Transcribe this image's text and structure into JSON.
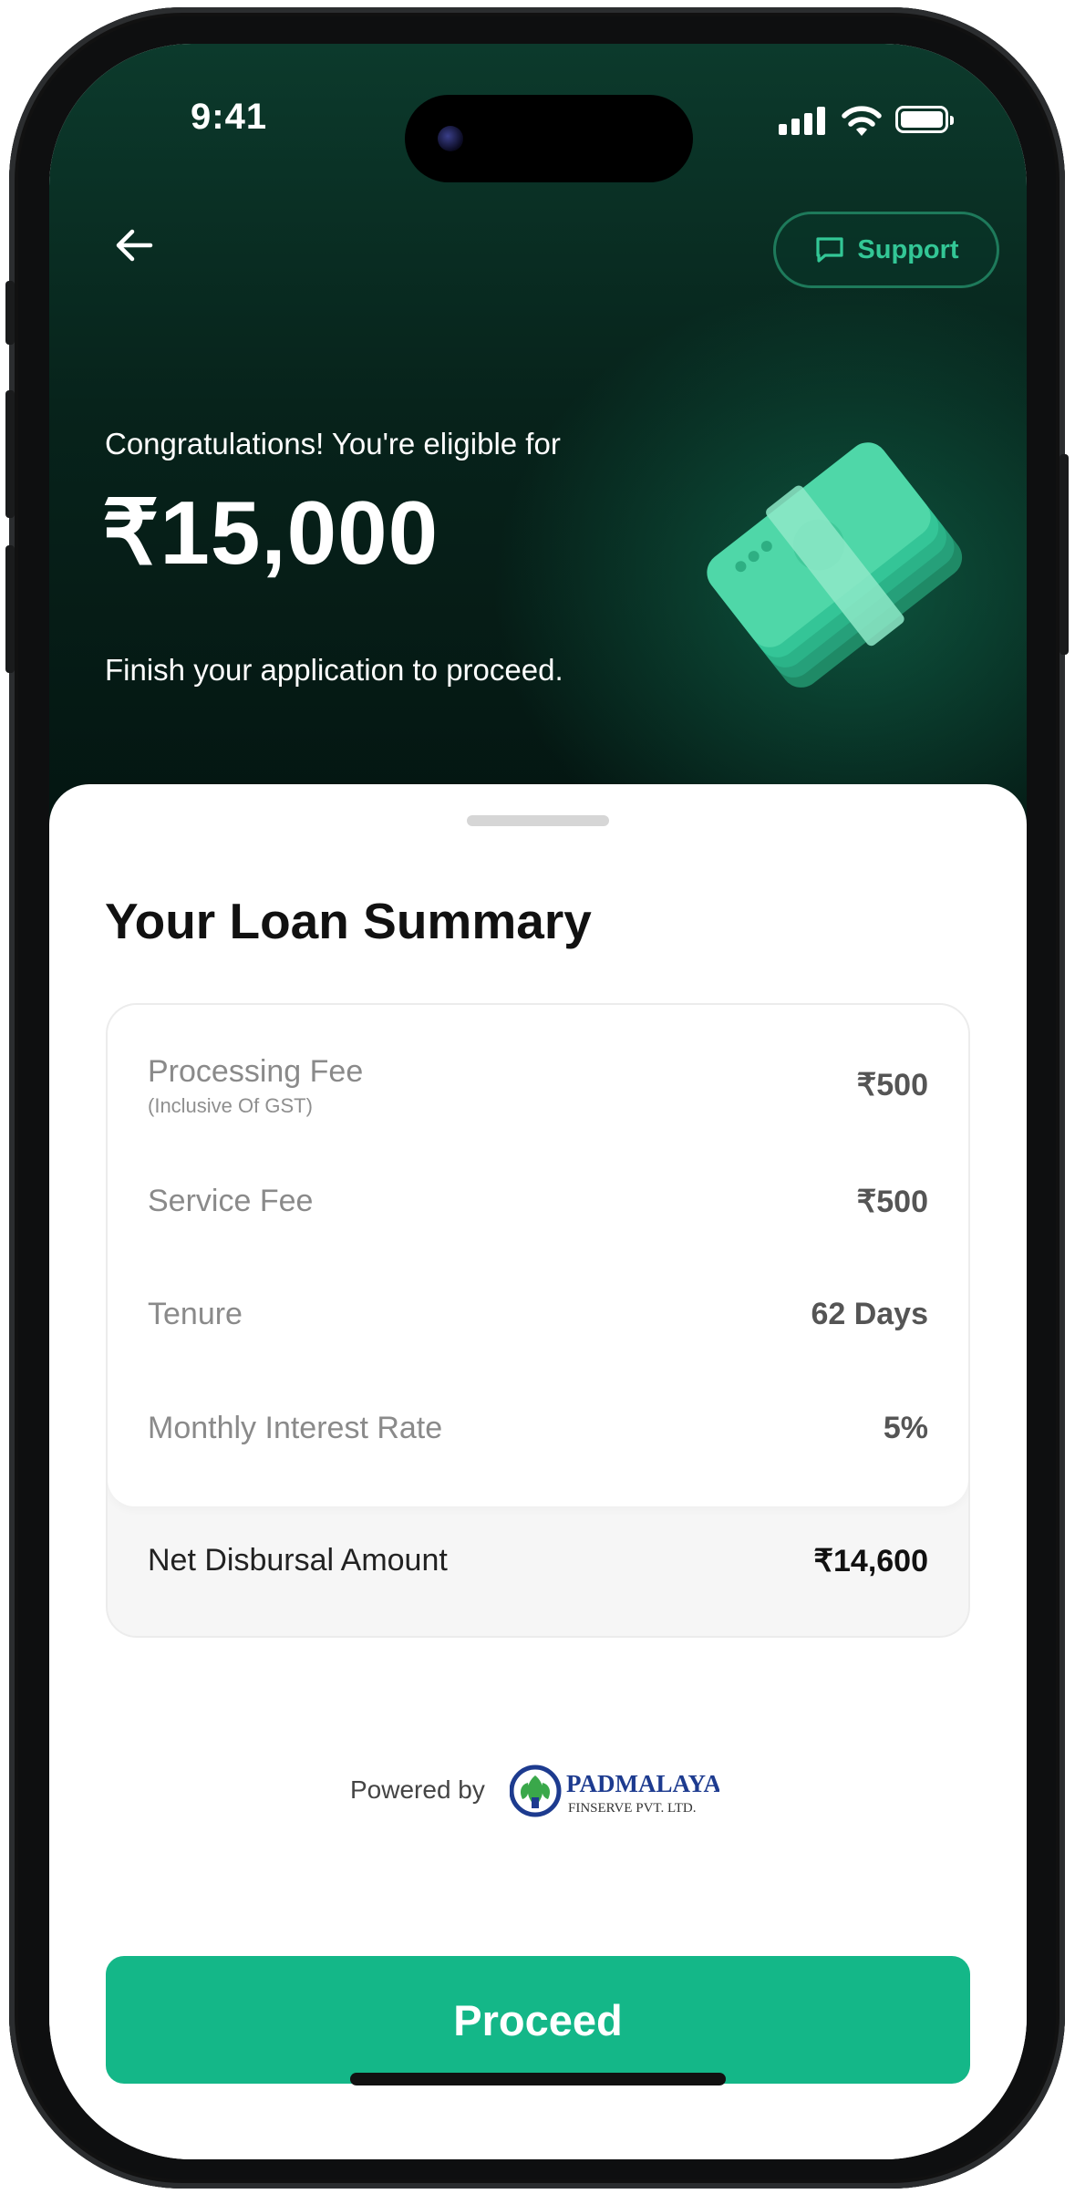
{
  "status": {
    "time": "9:41"
  },
  "header": {
    "support_label": "Support",
    "eligible_text": "Congratulations! You're eligible for",
    "eligible_amount": "₹15,000",
    "subtitle": "Finish your application to proceed."
  },
  "summary": {
    "title": "Your Loan Summary",
    "rows": [
      {
        "label": "Processing Fee",
        "sublabel": "(Inclusive Of GST)",
        "value": "₹500"
      },
      {
        "label": "Service Fee",
        "value": "₹500"
      },
      {
        "label": "Tenure",
        "value": "62 Days"
      },
      {
        "label": "Monthly Interest Rate",
        "value": "5%"
      }
    ],
    "net": {
      "label": "Net Disbursal Amount",
      "value": "₹14,600"
    }
  },
  "powered_by": {
    "text": "Powered by",
    "brand": "PADMALAYA",
    "brand_sub": "FINSERVE PVT. LTD."
  },
  "cta": {
    "label": "Proceed"
  },
  "colors": {
    "accent": "#14b788",
    "support_text": "#33c796",
    "hero_dark": "#041511"
  }
}
